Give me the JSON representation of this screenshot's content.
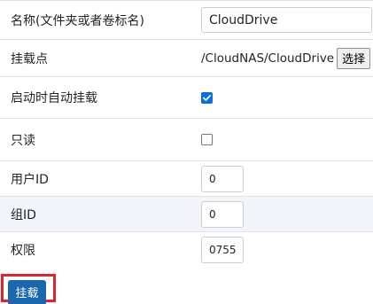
{
  "form": {
    "name_label": "名称(文件夹或者卷标名)",
    "name_value": "CloudDrive",
    "mount_point_label": "挂载点",
    "mount_point_value": "/CloudNAS/CloudDrive",
    "select_button_label": "选择",
    "auto_mount_label": "启动时自动挂载",
    "auto_mount_checked": true,
    "read_only_label": "只读",
    "read_only_checked": false,
    "uid_label": "用户ID",
    "uid_value": "0",
    "gid_label": "组ID",
    "gid_value": "0",
    "permission_label": "权限",
    "permission_value": "0755"
  },
  "actions": {
    "mount_button_label": "挂载"
  },
  "colors": {
    "primary_button": "#1a67ad",
    "highlight_frame": "#e0242f",
    "checkbox_checked": "#0b6fde",
    "striped_row": "#f2f6fa"
  }
}
